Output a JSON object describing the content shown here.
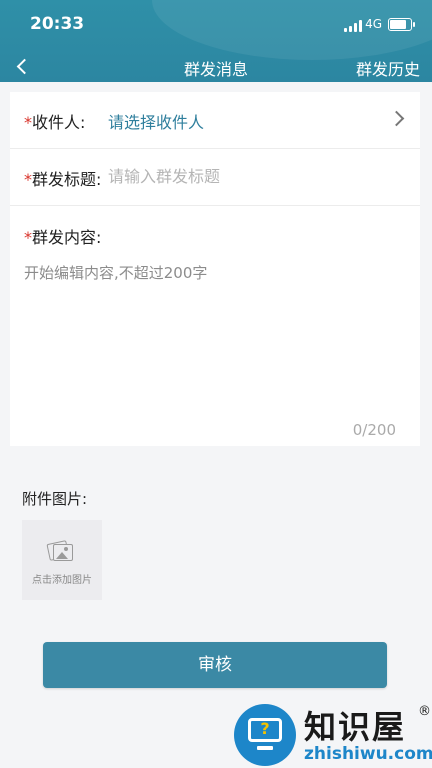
{
  "status_bar": {
    "time": "20:33",
    "network": "4G"
  },
  "nav": {
    "title": "群发消息",
    "history_label": "群发历史"
  },
  "form": {
    "required_mark": "*",
    "recipient": {
      "label": "收件人:",
      "value": "请选择收件人"
    },
    "title_field": {
      "label": "群发标题:",
      "placeholder": "请输入群发标题"
    },
    "content_field": {
      "label": "群发内容:",
      "placeholder": "开始编辑内容,不超过200字",
      "counter": "0/200"
    }
  },
  "attachments": {
    "label": "附件图片:",
    "add_text": "点击添加图片"
  },
  "submit": {
    "label": "审核"
  },
  "watermark": {
    "text_cn": "知识屋",
    "text_en": "zhishiwu.com",
    "reg": "®"
  },
  "colors": {
    "header": "#2f90a8",
    "accent": "#2f7f9d",
    "button": "#3b89a5",
    "required": "#d9342b"
  }
}
